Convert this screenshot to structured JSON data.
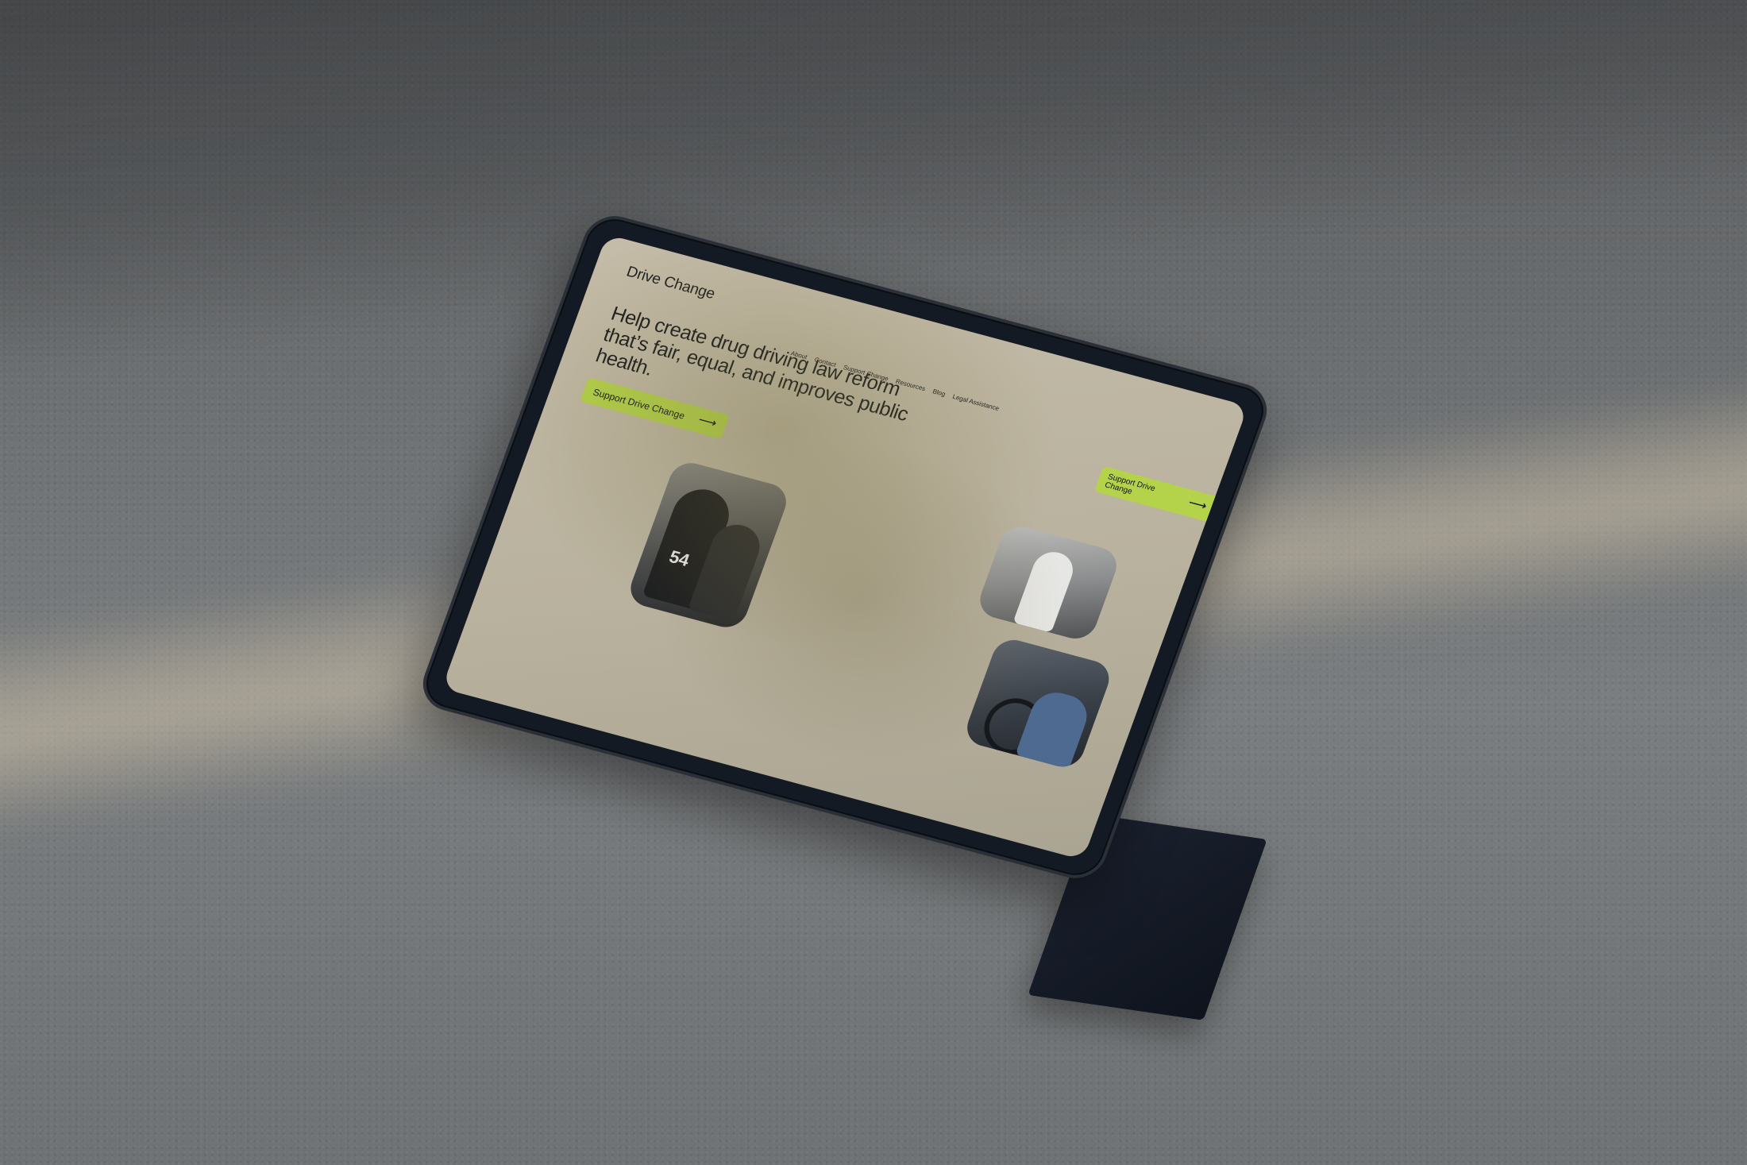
{
  "site": {
    "logo": "Drive Change",
    "nav": [
      "About",
      "Contact",
      "Support Change",
      "Resources",
      "Blog",
      "Legal Assistance"
    ],
    "headline": "Help create drug driving law reform that’s fair, equal, and improves public health.",
    "cta_primary": "Support Drive Change",
    "cta_header": "Support Drive Change",
    "arrow": "⟶",
    "jersey_number": "54",
    "accent_color": "#b4d24a"
  }
}
